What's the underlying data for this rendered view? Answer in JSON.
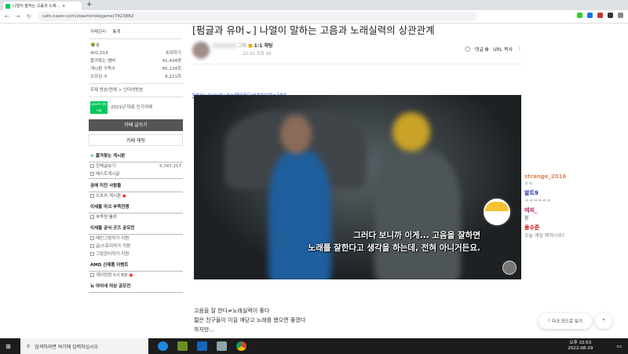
{
  "browser": {
    "tab_title": "나얼이 말하는 고음과 노래...",
    "url": "cafe.naver.com/steamindiegame/7423882"
  },
  "sidebar": {
    "manage": "카페관리",
    "stats": "통계",
    "level": "숲",
    "members": "401,014",
    "invite": "초대하기",
    "stats_rows": [
      {
        "label": "즐겨찾는 멤버",
        "value": "41,434명"
      },
      {
        "label": "게시판 구독수",
        "value": "65,124회"
      },
      {
        "label": "소모임 수",
        "value": "6,221회"
      }
    ],
    "topic": "주제 방송/연예 > 인터넷방송",
    "badge": "NAVER 대표카페",
    "award": "2021년 대표 인기카페",
    "write_btn": "카페 글쓰기",
    "chat_btn": "카페 채팅",
    "favorites": "즐겨찾는 게시판",
    "sections": [
      {
        "items": [
          {
            "label": "전체글보기",
            "count": "5,747,217"
          },
          {
            "label": "베스트게시글"
          }
        ]
      },
      {
        "title": "공예 미친 사람들",
        "items": [
          {
            "label": "스포츠 게시판",
            "new": true
          }
        ]
      },
      {
        "title": "이세돌 마크 부족전쟁",
        "items": [
          {
            "label": "부족원 룰루"
          }
        ]
      },
      {
        "title": "이세돌 공식 굿즈 공모전",
        "items": [
          {
            "label": "메인그림작가 지원"
          },
          {
            "label": "글/스토리작가 지원"
          },
          {
            "label": "그림콘티작가 지원"
          }
        ]
      },
      {
        "title": "AMD 신제품 이벤트",
        "items": [
          {
            "label": "게이밍컴 5시 8분",
            "new": true
          }
        ]
      },
      {
        "title": "뉴 아이네 의상 공모전",
        "items": []
      }
    ]
  },
  "post": {
    "title": "[펌글과 유머⌄] 나얼이 말하는 고음과 노래실력의 상관관계",
    "author_suffix": "그지",
    "chat_label": "1:1 채팅",
    "meta": "22:31  조회 16",
    "comment_label": "댓글",
    "comment_count": "0",
    "url_copy": "URL 복사",
    "link": "https://youtu.be/lBGFCp6A0sI?t=194",
    "subtitle1": "그러다 보니까 이게... 고음을 잘하면",
    "subtitle2": "노래를 잘한다고 생각을 하는데, 전혀 아니거든요.",
    "body": [
      "고음을 잘 한다≠노래실력이 좋다",
      "젊은 친구들이 이걸 깨닫고 노래를 했으면 좋겠다",
      "하지만..."
    ]
  },
  "chat": [
    {
      "name": "strange_2016",
      "msg": "ㅎㅇ",
      "color": "#e0845a"
    },
    {
      "name": "알트9",
      "msg": "ㅋㅋㅋㅋㅋㅋ",
      "color": "#1a2fb0"
    },
    {
      "name": "떼찌_",
      "msg": "응",
      "color": "#c23a7a"
    },
    {
      "name": "용수준",
      "msg": "오늘 게임 뭐하나요?",
      "color": "#c00000"
    }
  ],
  "dark_mode": "다크 모드로 보기",
  "taskbar": {
    "search": "검색하려면 여기에 입력하십시오",
    "time": "오후 10:53",
    "date": "2022-08-29"
  }
}
